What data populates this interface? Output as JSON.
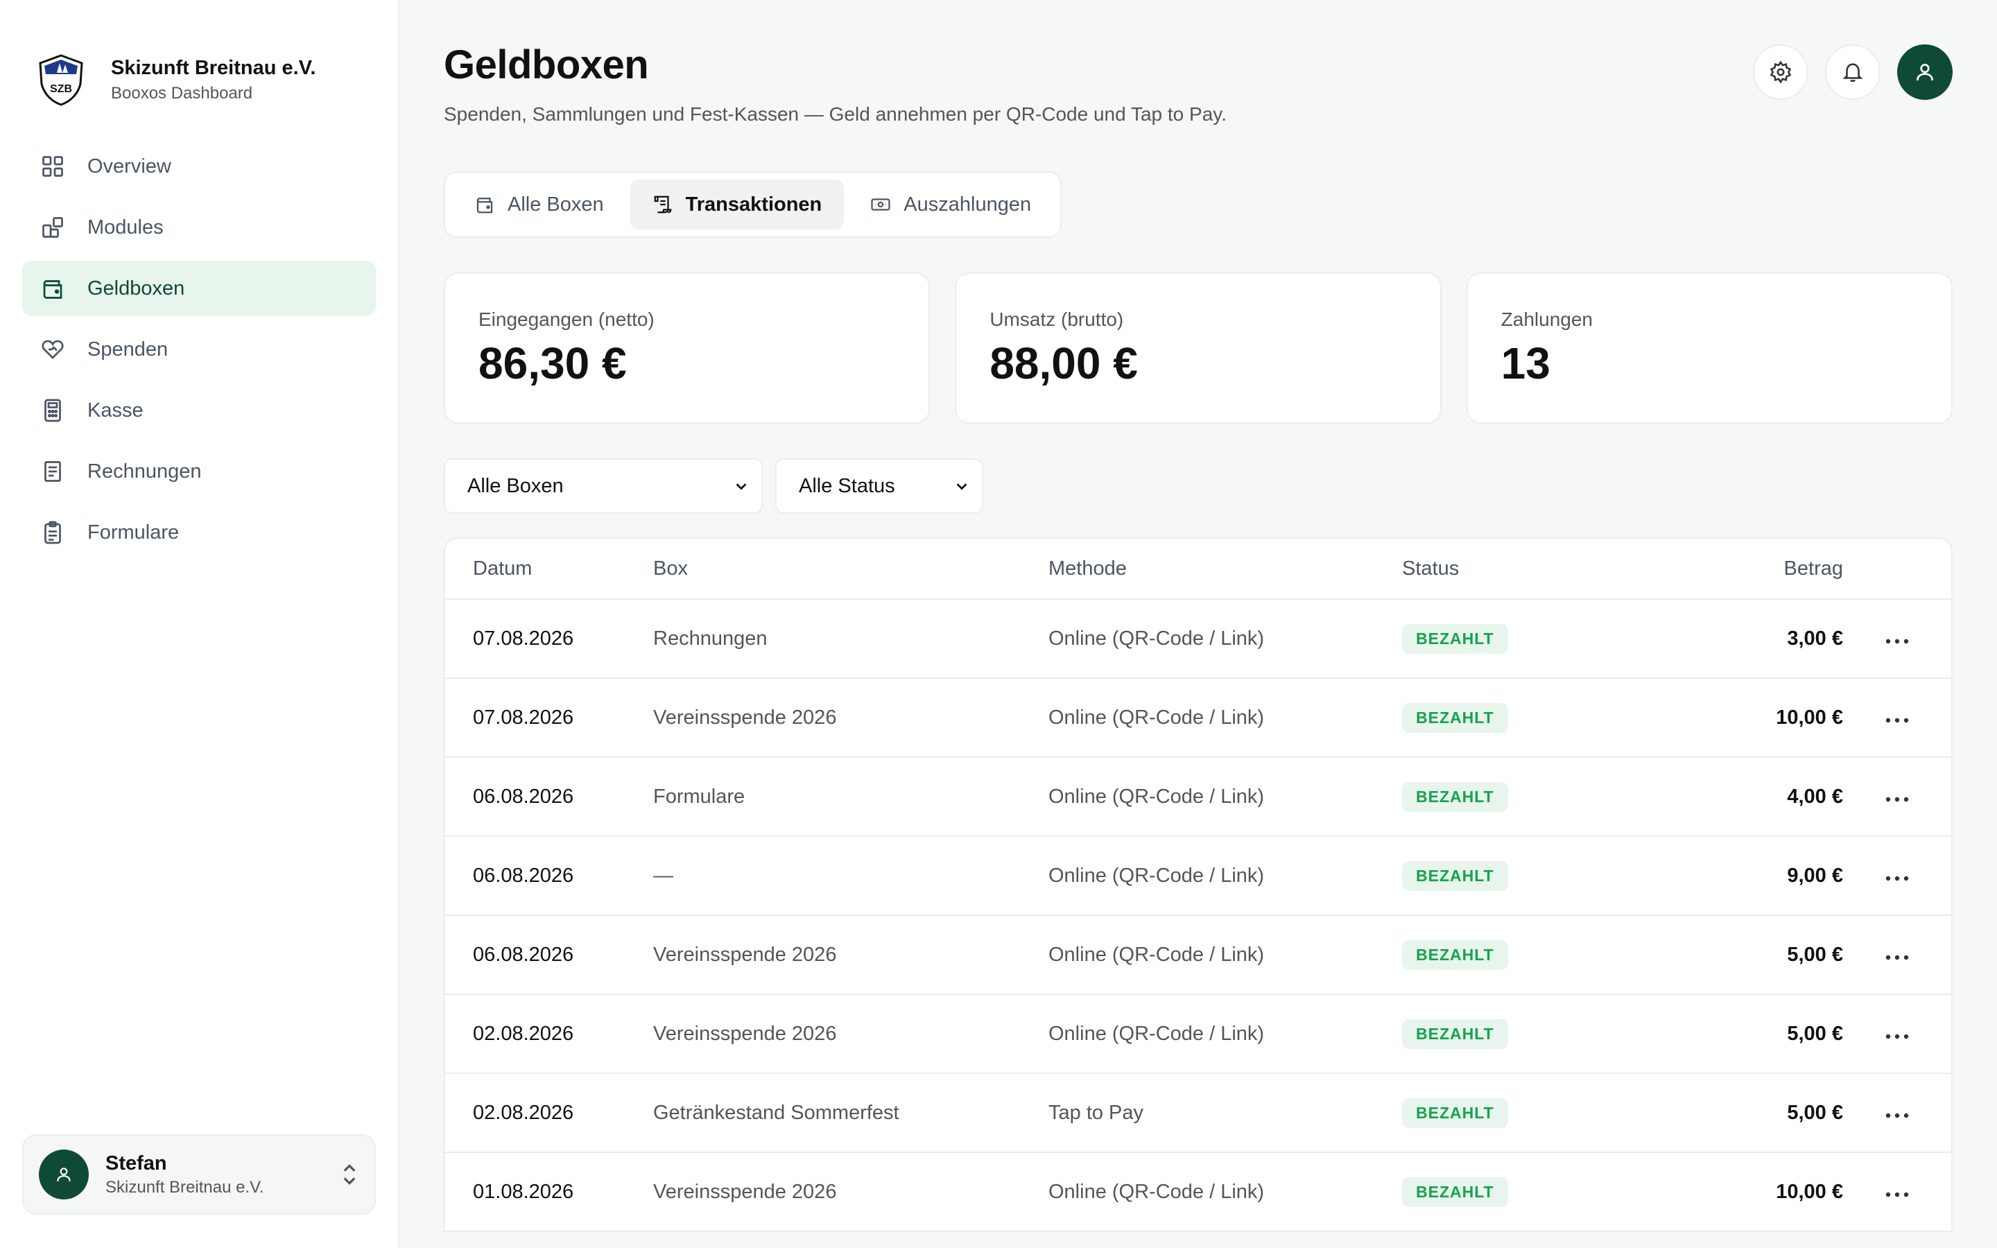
{
  "sidebar": {
    "org_name": "Skizunft Breitnau e.V.",
    "org_sub": "Booxos Dashboard",
    "logo_text": "SZB",
    "items": [
      {
        "label": "Overview",
        "icon": "grid-icon"
      },
      {
        "label": "Modules",
        "icon": "modules-icon"
      },
      {
        "label": "Geldboxen",
        "icon": "wallet-icon",
        "active": true
      },
      {
        "label": "Spenden",
        "icon": "heart-hand-icon"
      },
      {
        "label": "Kasse",
        "icon": "calculator-icon"
      },
      {
        "label": "Rechnungen",
        "icon": "receipt-icon"
      },
      {
        "label": "Formulare",
        "icon": "clipboard-icon"
      }
    ],
    "user": {
      "name": "Stefan",
      "org": "Skizunft Breitnau e.V."
    }
  },
  "header": {
    "title": "Geldboxen",
    "subtitle": "Spenden, Sammlungen und Fest-Kassen — Geld annehmen per QR-Code und Tap to Pay."
  },
  "tabs": [
    {
      "label": "Alle Boxen",
      "icon": "wallet-icon"
    },
    {
      "label": "Transaktionen",
      "icon": "scroll-icon",
      "active": true
    },
    {
      "label": "Auszahlungen",
      "icon": "banknote-icon"
    }
  ],
  "stats": [
    {
      "label": "Eingegangen (netto)",
      "value": "86,30 €"
    },
    {
      "label": "Umsatz (brutto)",
      "value": "88,00 €"
    },
    {
      "label": "Zahlungen",
      "value": "13"
    }
  ],
  "filters": {
    "box": "Alle Boxen",
    "status": "Alle Status"
  },
  "table": {
    "headers": {
      "date": "Datum",
      "box": "Box",
      "method": "Methode",
      "status": "Status",
      "amount": "Betrag"
    },
    "rows": [
      {
        "date": "07.08.2026",
        "box": "Rechnungen",
        "method": "Online (QR-Code / Link)",
        "status": "BEZAHLT",
        "amount": "3,00 €"
      },
      {
        "date": "07.08.2026",
        "box": "Vereinsspende 2026",
        "method": "Online (QR-Code / Link)",
        "status": "BEZAHLT",
        "amount": "10,00 €"
      },
      {
        "date": "06.08.2026",
        "box": "Formulare",
        "method": "Online (QR-Code / Link)",
        "status": "BEZAHLT",
        "amount": "4,00 €"
      },
      {
        "date": "06.08.2026",
        "box": "—",
        "method": "Online (QR-Code / Link)",
        "status": "BEZAHLT",
        "amount": "9,00 €"
      },
      {
        "date": "06.08.2026",
        "box": "Vereinsspende 2026",
        "method": "Online (QR-Code / Link)",
        "status": "BEZAHLT",
        "amount": "5,00 €"
      },
      {
        "date": "02.08.2026",
        "box": "Vereinsspende 2026",
        "method": "Online (QR-Code / Link)",
        "status": "BEZAHLT",
        "amount": "5,00 €"
      },
      {
        "date": "02.08.2026",
        "box": "Getränkestand Sommerfest",
        "method": "Tap to Pay",
        "status": "BEZAHLT",
        "amount": "5,00 €"
      },
      {
        "date": "01.08.2026",
        "box": "Vereinsspende 2026",
        "method": "Online (QR-Code / Link)",
        "status": "BEZAHLT",
        "amount": "10,00 €"
      }
    ]
  },
  "colors": {
    "accent": "#0f4a34",
    "active_bg": "#e7f5ec",
    "badge_text": "#16a34a"
  }
}
